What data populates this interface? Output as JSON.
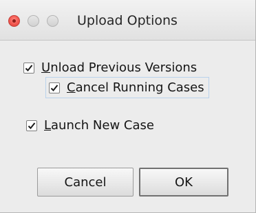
{
  "window": {
    "title": "Upload Options"
  },
  "options": {
    "unload_previous": {
      "mnemonic": "U",
      "label_rest": "nload Previous Versions",
      "checked": true
    },
    "cancel_running": {
      "mnemonic": "C",
      "label_rest": "ancel Running Cases",
      "checked": true
    },
    "launch_new": {
      "mnemonic": "L",
      "label_rest": "aunch New Case",
      "checked": true
    }
  },
  "buttons": {
    "cancel_label": "Cancel",
    "ok_label": "OK"
  },
  "colors": {
    "close_button": "#f2574f",
    "focus_ring": "#b9d2ec"
  }
}
